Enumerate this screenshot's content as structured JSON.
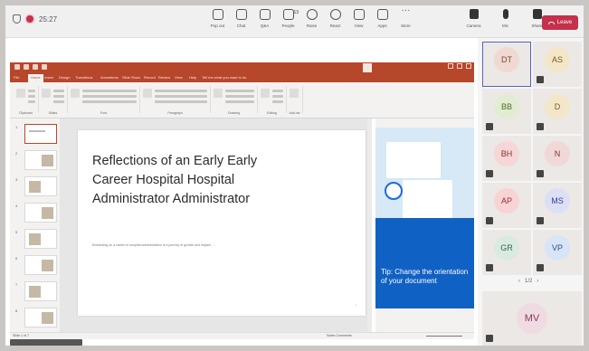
{
  "teams": {
    "time": "25:27",
    "toolbar": [
      {
        "label": "Pop out",
        "icon": "pop-out-icon"
      },
      {
        "label": "Chat",
        "icon": "chat-icon"
      },
      {
        "label": "Q&A",
        "icon": "qa-icon"
      },
      {
        "label": "People",
        "icon": "people-icon",
        "count": "13"
      },
      {
        "label": "Raise",
        "icon": "raise-hand-icon"
      },
      {
        "label": "React",
        "icon": "react-icon"
      },
      {
        "label": "View",
        "icon": "view-icon"
      },
      {
        "label": "Apps",
        "icon": "apps-icon"
      },
      {
        "label": "More",
        "icon": "more-icon"
      }
    ],
    "camera_label": "Camera",
    "mic_label": "Mic",
    "share_label": "Share",
    "leave_label": "Leave",
    "leave_color": "#c4314b"
  },
  "powerpoint": {
    "accent": "#b7472a",
    "tabs": [
      "File",
      "Home",
      "Insert",
      "Design",
      "Transitions",
      "Animations",
      "Slide Show",
      "Record",
      "Review",
      "View",
      "Help",
      "Tell me what you want to do"
    ],
    "ribbon_groups": [
      "Clipboard",
      "Slides",
      "Font",
      "Paragraph",
      "Drawing",
      "Editing",
      "Add-ins"
    ],
    "slide_count": 8,
    "slide_title": "Reflections of an Early Early Career Hospital Hospital Administrator Administrator",
    "slide_body": "Embarking on a career in hospital administration is a journey of growth and impact. ...",
    "tip_text": "Tip: Change the orientation of your document",
    "status_left": "Slide 1 of 7",
    "status_right": "Notes  Comments"
  },
  "participants": [
    {
      "initials": "DT",
      "bg": "#efd9d2",
      "fg": "#7a4a3a",
      "active": true
    },
    {
      "initials": "AS",
      "bg": "#f3e6c9",
      "fg": "#7a5b1f"
    },
    {
      "initials": "BB",
      "bg": "#e2ecd2",
      "fg": "#4e6b2a"
    },
    {
      "initials": "D",
      "bg": "#f3e6c9",
      "fg": "#7a5b1f"
    },
    {
      "initials": "BH",
      "bg": "#f6d6d6",
      "fg": "#8a2f2f"
    },
    {
      "initials": "N",
      "bg": "#f1d8d8",
      "fg": "#8a2f2f"
    },
    {
      "initials": "AP",
      "bg": "#f7d3d6",
      "fg": "#9a2f3a"
    },
    {
      "initials": "MS",
      "bg": "#dcdff6",
      "fg": "#3a3f8a"
    },
    {
      "initials": "GR",
      "bg": "#d9ebe0",
      "fg": "#2f6a45"
    },
    {
      "initials": "VP",
      "bg": "#d8e4f7",
      "fg": "#2f4f8a"
    }
  ],
  "pager": "1/2",
  "featured": {
    "initials": "MV",
    "bg": "#f0dbe2",
    "fg": "#8a3a55"
  }
}
